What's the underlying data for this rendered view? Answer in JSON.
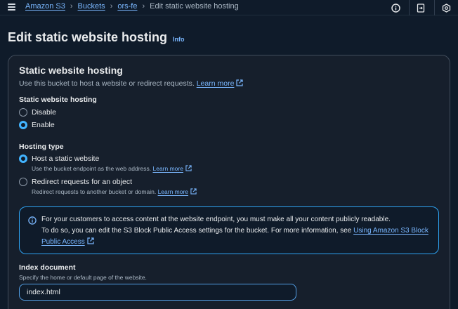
{
  "topbar": {
    "menu_icon": "hamburger-menu-icon",
    "breadcrumbs": [
      "Amazon S3",
      "Buckets",
      "ors-fe"
    ],
    "current": "Edit static website hosting",
    "icons": [
      "info-circle-icon",
      "exit-panel-icon",
      "settings-hexagon-icon"
    ]
  },
  "page": {
    "title": "Edit static website hosting",
    "info": "Info"
  },
  "panel": {
    "title": "Static website hosting",
    "description": "Use this bucket to host a website or redirect requests.",
    "learn_more": "Learn more",
    "hosting_label": "Static website hosting",
    "hosting_options": [
      {
        "label": "Disable",
        "selected": false
      },
      {
        "label": "Enable",
        "selected": true
      }
    ],
    "type_label": "Hosting type",
    "type_options": [
      {
        "label": "Host a static website",
        "description": "Use the bucket endpoint as the web address.",
        "learn_more": "Learn more",
        "selected": true
      },
      {
        "label": "Redirect requests for an object",
        "description": "Redirect requests to another bucket or domain.",
        "learn_more": "Learn more",
        "selected": false
      }
    ],
    "alert": {
      "text_1": "For your customers to access content at the website endpoint, you must make all your content publicly readable.",
      "text_2": "To do so, you can edit the S3 Block Public Access settings for the bucket. For more information, see",
      "link": "Using Amazon S3 Block Public Access"
    },
    "index": {
      "label": "Index document",
      "description": "Specify the home or default page of the website.",
      "value": "index.html"
    }
  },
  "colors": {
    "background": "#0f1b2a",
    "panel": "#161f2c",
    "link": "#7ab7ff",
    "accent": "#42b4ff",
    "alert_border": "#2ea3f2"
  }
}
